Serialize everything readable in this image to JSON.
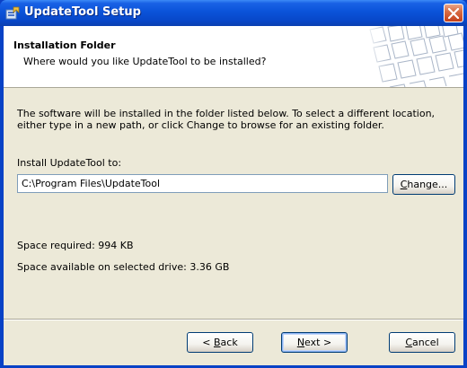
{
  "window": {
    "title": "UpdateTool Setup"
  },
  "header": {
    "title": "Installation Folder",
    "subtitle": "Where would you like UpdateTool to be installed?"
  },
  "body": {
    "description": "The software will be installed in the folder listed below. To select a different location, either type in a new path, or click Change to browse for an existing folder.",
    "install_label": "Install UpdateTool to:",
    "install_path": "C:\\Program Files\\UpdateTool",
    "space_required": "Space required: 994 KB",
    "space_available": "Space available on selected drive: 3.36 GB"
  },
  "buttons": {
    "change": {
      "before": "",
      "accel": "C",
      "after": "hange..."
    },
    "back": {
      "before": "< ",
      "accel": "B",
      "after": "ack"
    },
    "next": {
      "before": "",
      "accel": "N",
      "after": "ext >"
    },
    "cancel": {
      "before": "",
      "accel": "C",
      "after": "ancel"
    }
  },
  "icons": {
    "title": "setup-app-icon",
    "close": "close-icon",
    "header_art": "keyboard-keys-art"
  },
  "colors": {
    "titlebar": "#0a53d9",
    "client": "#ece9d8",
    "close_button": "#d86e45",
    "input_border": "#7f9db9"
  }
}
